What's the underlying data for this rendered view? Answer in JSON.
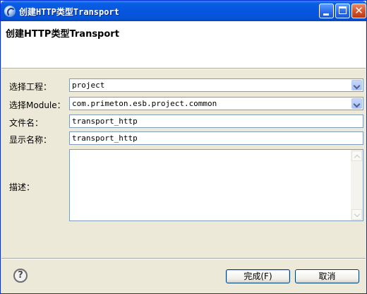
{
  "window": {
    "title": "创建HTTP类型Transport"
  },
  "header": {
    "title": "创建HTTP类型Transport"
  },
  "form": {
    "project_label": "选择工程：",
    "project_value": "project",
    "module_label": "选择Module：",
    "module_value": "com.primeton.esb.project.common",
    "filename_label": "文件名：",
    "filename_value": "transport_http",
    "display_name_label": "显示名称：",
    "display_name_value": "transport_http",
    "description_label": "描述：",
    "description_value": ""
  },
  "buttons": {
    "help": "?",
    "finish": "完成(F)",
    "cancel": "取消"
  },
  "icons": {
    "app": "eclipse-app-icon",
    "minimize": "minimize-icon",
    "maximize": "maximize-icon",
    "close": "close-icon",
    "help": "help-icon",
    "dropdown": "chevron-down-icon"
  },
  "colors": {
    "titlebar": "#0554d8",
    "field_border": "#7f9db9",
    "background": "#ece9d8"
  }
}
